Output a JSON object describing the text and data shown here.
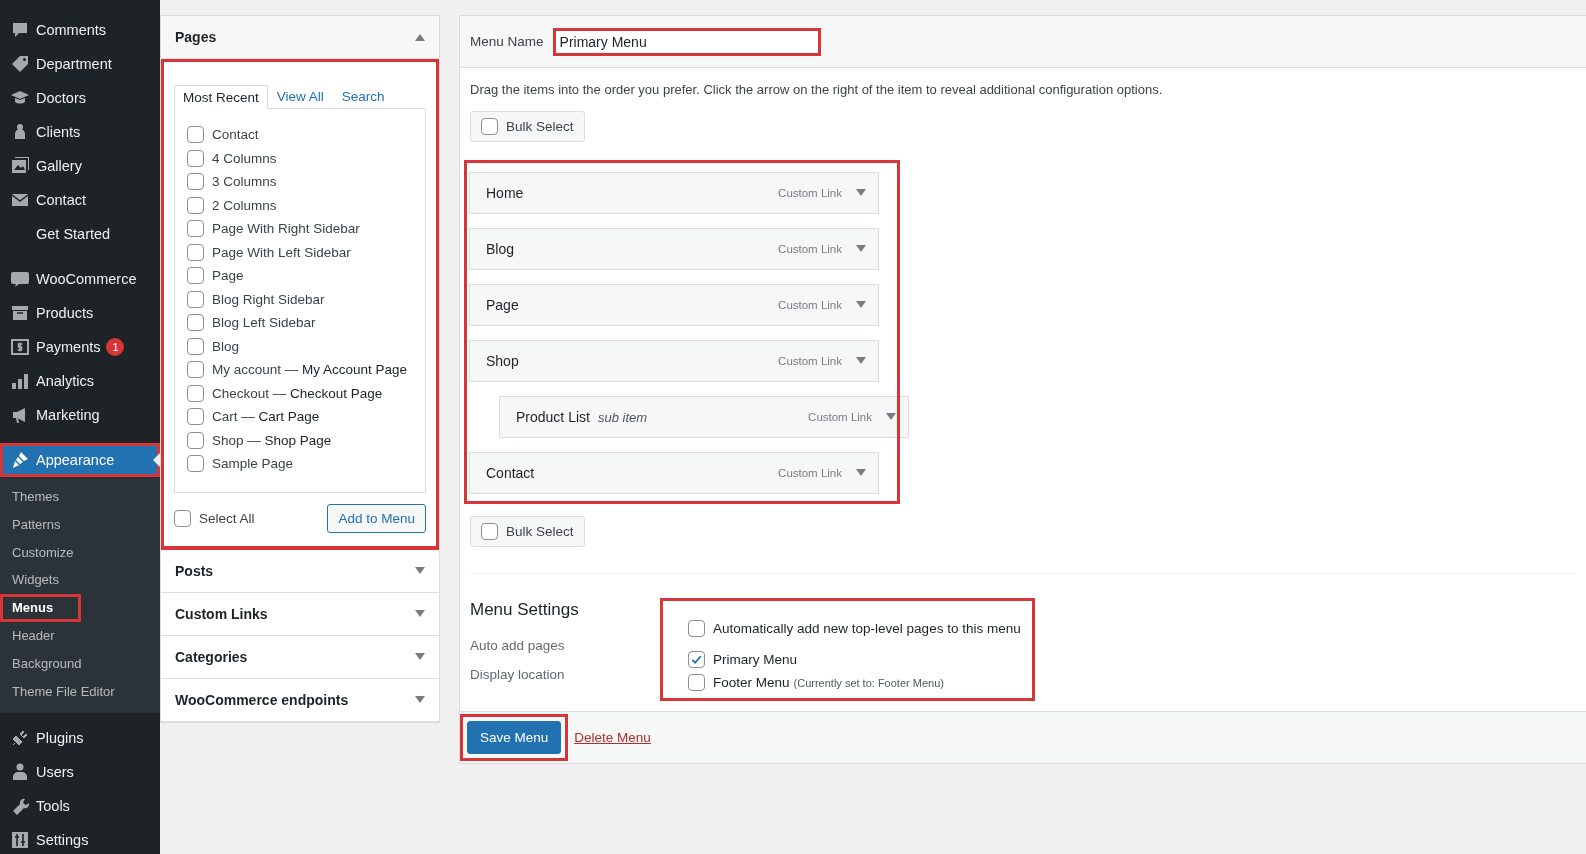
{
  "sidebar": {
    "sections": [
      [
        {
          "label": "Comments",
          "selected": false
        },
        {
          "label": "Department",
          "selected": false
        },
        {
          "label": "Doctors",
          "selected": false
        },
        {
          "label": "Clients",
          "selected": false
        },
        {
          "label": "Gallery",
          "selected": false
        },
        {
          "label": "Contact",
          "selected": false
        },
        {
          "label": "Get Started",
          "selected": false
        }
      ],
      [
        {
          "label": "WooCommerce",
          "selected": false
        },
        {
          "label": "Products",
          "selected": false
        },
        {
          "label": "Payments",
          "selected": false,
          "badge": "1"
        },
        {
          "label": "Analytics",
          "selected": false
        },
        {
          "label": "Marketing",
          "selected": false
        }
      ],
      [
        {
          "label": "Appearance",
          "selected": true,
          "highlighted": true,
          "submenu": [
            {
              "label": "Themes",
              "selected": false,
              "highlighted": false
            },
            {
              "label": "Patterns",
              "selected": false,
              "highlighted": false
            },
            {
              "label": "Customize",
              "selected": false,
              "highlighted": false
            },
            {
              "label": "Widgets",
              "selected": false,
              "highlighted": false
            },
            {
              "label": "Menus",
              "selected": true,
              "highlighted": true
            },
            {
              "label": "Header",
              "selected": false,
              "highlighted": false
            },
            {
              "label": "Background",
              "selected": false,
              "highlighted": false
            },
            {
              "label": "Theme File Editor",
              "selected": false,
              "highlighted": false
            }
          ]
        },
        {
          "label": "Plugins",
          "selected": false
        },
        {
          "label": "Users",
          "selected": false
        },
        {
          "label": "Tools",
          "selected": false
        },
        {
          "label": "Settings",
          "selected": false
        }
      ]
    ]
  },
  "accordions": [
    {
      "title": "Pages",
      "expanded": true,
      "highlighted": true,
      "tabs": [
        {
          "label": "Most Recent",
          "selected": true
        },
        {
          "label": "View All",
          "selected": false
        },
        {
          "label": "Search",
          "selected": false
        }
      ],
      "items": [
        {
          "label": "Contact",
          "checked": false
        },
        {
          "label": "4 Columns",
          "checked": false
        },
        {
          "label": "3 Columns",
          "checked": false
        },
        {
          "label": "2 Columns",
          "checked": false
        },
        {
          "label": "Page With Right Sidebar",
          "checked": false
        },
        {
          "label": "Page With Left Sidebar",
          "checked": false
        },
        {
          "label": "Page",
          "checked": false
        },
        {
          "label": "Blog Right Sidebar",
          "checked": false
        },
        {
          "label": "Blog Left Sidebar",
          "checked": false
        },
        {
          "label": "Blog",
          "checked": false
        },
        {
          "label": "My account — **My Account Page**",
          "checked": false
        },
        {
          "label": "Checkout — **Checkout Page**",
          "checked": false
        },
        {
          "label": "Cart — **Cart Page**",
          "checked": false
        },
        {
          "label": "Shop — **Shop Page**",
          "checked": false
        },
        {
          "label": "Sample Page",
          "checked": false
        }
      ],
      "select_all": {
        "label": "Select All",
        "checked": false
      },
      "add_button": "Add to Menu"
    },
    {
      "title": "Posts",
      "expanded": false,
      "highlighted": false
    },
    {
      "title": "Custom Links",
      "expanded": false,
      "highlighted": false
    },
    {
      "title": "Categories",
      "expanded": false,
      "highlighted": false
    },
    {
      "title": "WooCommerce endpoints",
      "expanded": false,
      "highlighted": false
    }
  ],
  "menu": {
    "name_label": "Menu Name",
    "name_value": "Primary Menu",
    "name_highlighted": true,
    "instructions": "Drag the items into the order you prefer. Click the arrow on the right of the item to reveal additional configuration options.",
    "bulk_top": {
      "label": "Bulk Select",
      "checked": false
    },
    "items_highlighted": true,
    "items": [
      {
        "title": "Home",
        "type": "Custom Link"
      },
      {
        "title": "Blog",
        "type": "Custom Link"
      },
      {
        "title": "Page",
        "type": "Custom Link"
      },
      {
        "title": "Shop",
        "type": "Custom Link",
        "children": [
          {
            "title": "Product List",
            "sub_label": "sub item",
            "type": "Custom Link"
          }
        ]
      },
      {
        "title": "Contact",
        "type": "Custom Link"
      }
    ],
    "bulk_bottom": {
      "label": "Bulk Select",
      "checked": false
    }
  },
  "settings": {
    "title": "Menu Settings",
    "highlighted": true,
    "labels": [
      "Auto add pages",
      "Display location"
    ],
    "groups": [
      [
        {
          "label": "Automatically add new top-level pages to this menu",
          "checked": false
        }
      ],
      [
        {
          "label": "Primary Menu",
          "checked": true
        },
        {
          "label": "Footer Menu",
          "note": "(Currently set to: Footer Menu)",
          "checked": false
        }
      ]
    ]
  },
  "footer": {
    "save": "Save Menu",
    "save_highlighted": true,
    "delete": "Delete Menu"
  }
}
